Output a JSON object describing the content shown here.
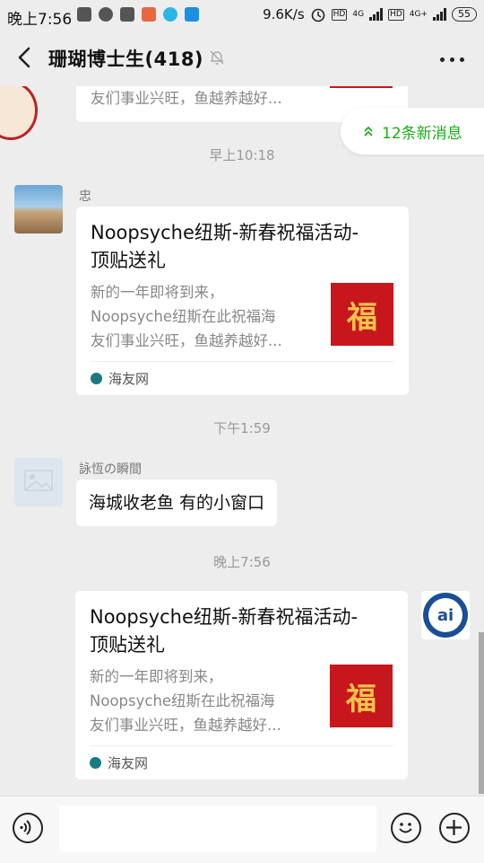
{
  "status_bar": {
    "time": "晚上7:56",
    "network_speed": "9.6K/s",
    "hd1": "HD",
    "net1": "4G",
    "hd2": "HD",
    "net2": "4G+",
    "battery": "55"
  },
  "header": {
    "title": "珊瑚博士生(418)"
  },
  "new_messages_label": "12条新消息",
  "messages": [
    {
      "desc_line3": "友们事业兴旺，鱼越养越好..."
    },
    {
      "timestamp": "早上10:18",
      "sender": "忠",
      "title": "Noopsyche纽斯-新春祝福活动-顶贴送礼",
      "desc": [
        "新的一年即将到来，",
        "Noopsyche纽斯在此祝福海",
        "友们事业兴旺，鱼越养越好..."
      ],
      "thumb_char": "福",
      "source": "海友网"
    },
    {
      "timestamp": "下午1:59",
      "sender": "詠恆の瞬間",
      "text": "海城收老鱼 有的小窗口"
    },
    {
      "timestamp": "晚上7:56",
      "title": "Noopsyche纽斯-新春祝福活动-顶贴送礼",
      "desc": [
        "新的一年即将到来，",
        "Noopsyche纽斯在此祝福海",
        "友们事业兴旺，鱼越养越好..."
      ],
      "thumb_char": "福",
      "source": "海友网"
    }
  ],
  "colors": {
    "accent_green": "#1aad19",
    "background": "#ededed",
    "thumb_red": "#c8161d"
  }
}
